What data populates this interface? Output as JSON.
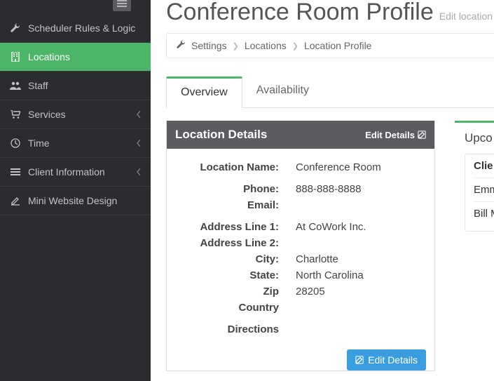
{
  "sidebar": {
    "items": [
      {
        "label": "Scheduler Rules & Logic"
      },
      {
        "label": "Locations"
      },
      {
        "label": "Staff"
      },
      {
        "label": "Services"
      },
      {
        "label": "Time"
      },
      {
        "label": "Client Information"
      },
      {
        "label": "Mini Website Design"
      }
    ]
  },
  "page": {
    "title": "Conference Room Profile",
    "subtitle": "Edit location details ar"
  },
  "breadcrumb": {
    "a": "Settings",
    "b": "Locations",
    "c": "Location Profile"
  },
  "tabs": {
    "overview": "Overview",
    "availability": "Availability"
  },
  "panel": {
    "title": "Location Details",
    "edit": "Edit Details"
  },
  "details": {
    "location_name_label": "Location Name:",
    "location_name": "Conference Room",
    "phone_label": "Phone:",
    "phone": "888-888-8888",
    "email_label": "Email:",
    "email": "",
    "addr1_label": "Address Line 1:",
    "addr1": "At CoWork Inc.",
    "addr2_label": "Address Line 2:",
    "addr2": "",
    "city_label": "City:",
    "city": "Charlotte",
    "state_label": "State:",
    "state": "North Carolina",
    "zip_label": "Zip",
    "zip": "28205",
    "country_label": "Country",
    "country": "",
    "directions_label": "Directions",
    "directions": ""
  },
  "button": {
    "edit": "Edit Details"
  },
  "side": {
    "title": "Upco",
    "header": "Clie",
    "r1": "Emm",
    "r2": "Bill M"
  }
}
